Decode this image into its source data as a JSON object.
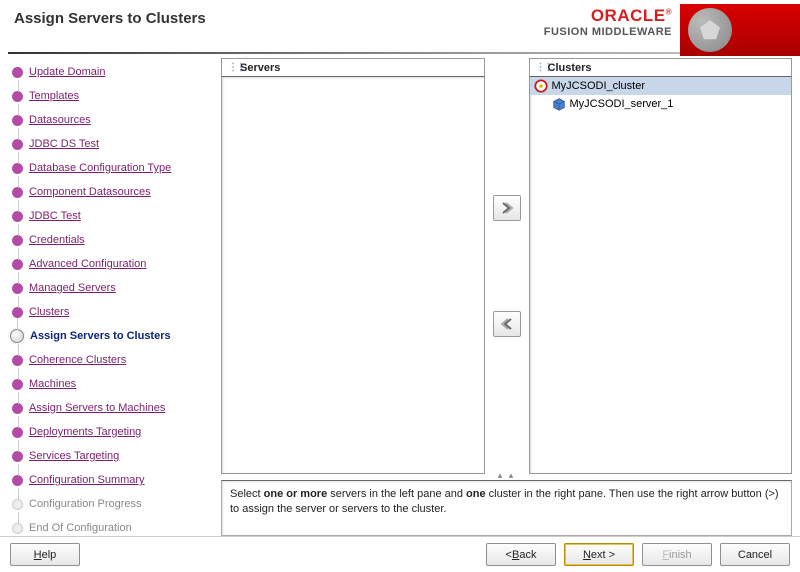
{
  "header": {
    "title": "Assign Servers to Clusters",
    "brand_top": "ORACLE",
    "brand_sub": "FUSION MIDDLEWARE"
  },
  "sidebar": {
    "steps": [
      {
        "label": "Update Domain",
        "state": "done"
      },
      {
        "label": "Templates",
        "state": "done"
      },
      {
        "label": "Datasources",
        "state": "done"
      },
      {
        "label": "JDBC DS Test",
        "state": "done"
      },
      {
        "label": "Database Configuration Type",
        "state": "done"
      },
      {
        "label": "Component Datasources",
        "state": "done"
      },
      {
        "label": "JDBC Test",
        "state": "done"
      },
      {
        "label": "Credentials",
        "state": "done"
      },
      {
        "label": "Advanced Configuration",
        "state": "done"
      },
      {
        "label": "Managed Servers",
        "state": "done"
      },
      {
        "label": "Clusters",
        "state": "done"
      },
      {
        "label": "Assign Servers to Clusters",
        "state": "current"
      },
      {
        "label": "Coherence Clusters",
        "state": "pending"
      },
      {
        "label": "Machines",
        "state": "pending"
      },
      {
        "label": "Assign Servers to Machines",
        "state": "pending"
      },
      {
        "label": "Deployments Targeting",
        "state": "pending"
      },
      {
        "label": "Services Targeting",
        "state": "pending"
      },
      {
        "label": "Configuration Summary",
        "state": "pending"
      },
      {
        "label": "Configuration Progress",
        "state": "future"
      },
      {
        "label": "End Of Configuration",
        "state": "future"
      }
    ]
  },
  "assign": {
    "servers_header": "Servers",
    "clusters_header": "Clusters",
    "clusters_tree": {
      "root": "MyJCSODI_cluster",
      "children": [
        "MyJCSODI_server_1"
      ]
    }
  },
  "hint": {
    "pre": "Select ",
    "bold1": "one or more",
    "mid1": " servers in the left pane and ",
    "bold2": "one",
    "mid2": " cluster in the right pane. Then use the right arrow button (>) to assign the server or servers to the cluster."
  },
  "footer": {
    "help": "Help",
    "back": "Back",
    "next": "Next",
    "finish": "Finish",
    "cancel": "Cancel"
  }
}
